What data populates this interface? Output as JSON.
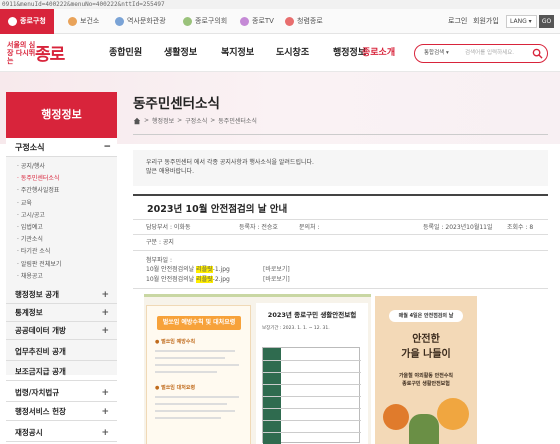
{
  "url_fragment": "0911&menuId=400222&menuNo=400222&nttId=255497",
  "topbar": {
    "tabs": [
      {
        "label": "종로구청",
        "active": true
      },
      {
        "label": "보건소",
        "active": false
      },
      {
        "label": "역사문화관광",
        "active": false
      },
      {
        "label": "종로구의회",
        "active": false
      },
      {
        "label": "종로TV",
        "active": false
      },
      {
        "label": "청렴종로",
        "active": false
      }
    ],
    "login": "로그인",
    "join": "회원가입",
    "lang": "LANG",
    "go": "GO"
  },
  "header": {
    "logo_small": "서울의 심장 다시뛰는",
    "logo_big": "종로",
    "gnb": [
      {
        "label": "종합민원",
        "active": false
      },
      {
        "label": "생활정보",
        "active": false
      },
      {
        "label": "복지정보",
        "active": false
      },
      {
        "label": "도시창조",
        "active": false
      },
      {
        "label": "행정정보",
        "active": false
      },
      {
        "label": "종로소개",
        "active": true
      }
    ],
    "search_category": "통합검색",
    "search_placeholder": "검색어를 입력하세요."
  },
  "lnb": {
    "title": "행정정보",
    "open_section": "구정소식",
    "sub_items": [
      {
        "label": "· 공지/행사",
        "active": false
      },
      {
        "label": "· 동주민센터소식",
        "active": true
      },
      {
        "label": "· 주간행사일정표",
        "active": false
      },
      {
        "label": "· 교육",
        "active": false
      },
      {
        "label": "· 고시/공고",
        "active": false
      },
      {
        "label": "· 입법예고",
        "active": false
      },
      {
        "label": "· 기관소식",
        "active": false
      },
      {
        "label": "· 타기관 소식",
        "active": false
      },
      {
        "label": "· 알림판 전체보기",
        "active": false
      },
      {
        "label": "· 채용공고",
        "active": false
      }
    ],
    "sections": [
      "행정정보 공개",
      "통계정보",
      "공공데이터 개방",
      "업무추진비 공개",
      "보조금지급 공개",
      "법령/자치법규",
      "행정서비스 헌장",
      "재정공시"
    ]
  },
  "content": {
    "page_title": "동주민센터소식",
    "breadcrumb": [
      "행정정보",
      "구정소식",
      "동주민센터소식"
    ],
    "notice_line1": "우리구 동주민센터 에서 각종 공지사항과 행사소식을 알려드립니다.",
    "notice_line2": "많은 애용바랍니다.",
    "post_title": "2023년 10월 안전점검의 날 안내",
    "meta": {
      "dept": "담당부서 : 이화동",
      "writer": "등록자 : 전승호",
      "contact": "문의처 :",
      "date": "등록일 : 2023년10월11일",
      "views": "조회수 : 8"
    },
    "category": "구분 : 공지",
    "attach_label": "첨부파일 :",
    "files": [
      {
        "pre": "10월 안전점검의날 ",
        "hl": "리플릿",
        "post": "-1.jpg",
        "preview": "[바로보기]"
      },
      {
        "pre": "10월 안전점검의날 ",
        "hl": "리플릿",
        "post": "-2.jpg",
        "preview": "[바로보기]"
      }
    ]
  },
  "poster1": {
    "left_tag": "벌쏘임 예방수칙 및 대처요령",
    "sec1": "● 벌쏘임 예방수칙",
    "sec2": "● 벌쏘임 대처요령",
    "right_title": "2023년 종로구민 생활안전보험",
    "right_sub": "보장기간 : 2023. 1. 1. ~ 12. 31."
  },
  "poster2": {
    "pill": "매월 4일은 안전점검의 날",
    "big1": "안전한",
    "big2": "가을 나들이",
    "small1": "가을철 야외활동 안전수칙",
    "small2": "종로구민 생활안전보험"
  }
}
